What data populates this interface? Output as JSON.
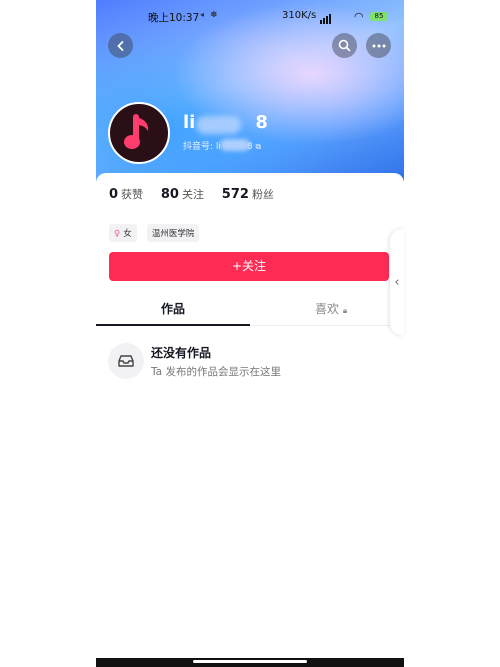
{
  "status_bar": {
    "time": "晚上10:37",
    "indicators": "◂ ✽",
    "net_speed": "310K/s",
    "battery": "85"
  },
  "header": {
    "back_icon": "back-icon",
    "search_icon": "search-icon",
    "more_icon": "more-icon",
    "username_visible_start": "li",
    "username_visible_end": "8",
    "douyin_id_label": "抖音号: li",
    "douyin_id_end": "8"
  },
  "stats": [
    {
      "value": "0",
      "label": "获赞"
    },
    {
      "value": "80",
      "label": "关注"
    },
    {
      "value": "572",
      "label": "粉丝"
    }
  ],
  "tags": {
    "gender": "女",
    "school": "温州医学院"
  },
  "follow_button": "+关注",
  "tabs": {
    "works": "作品",
    "likes": "喜欢"
  },
  "empty_state": {
    "title": "还没有作品",
    "subtitle": "Ta 发布的作品会显示在这里"
  },
  "colors": {
    "accent": "#fe2c55",
    "text_primary": "#161823"
  }
}
